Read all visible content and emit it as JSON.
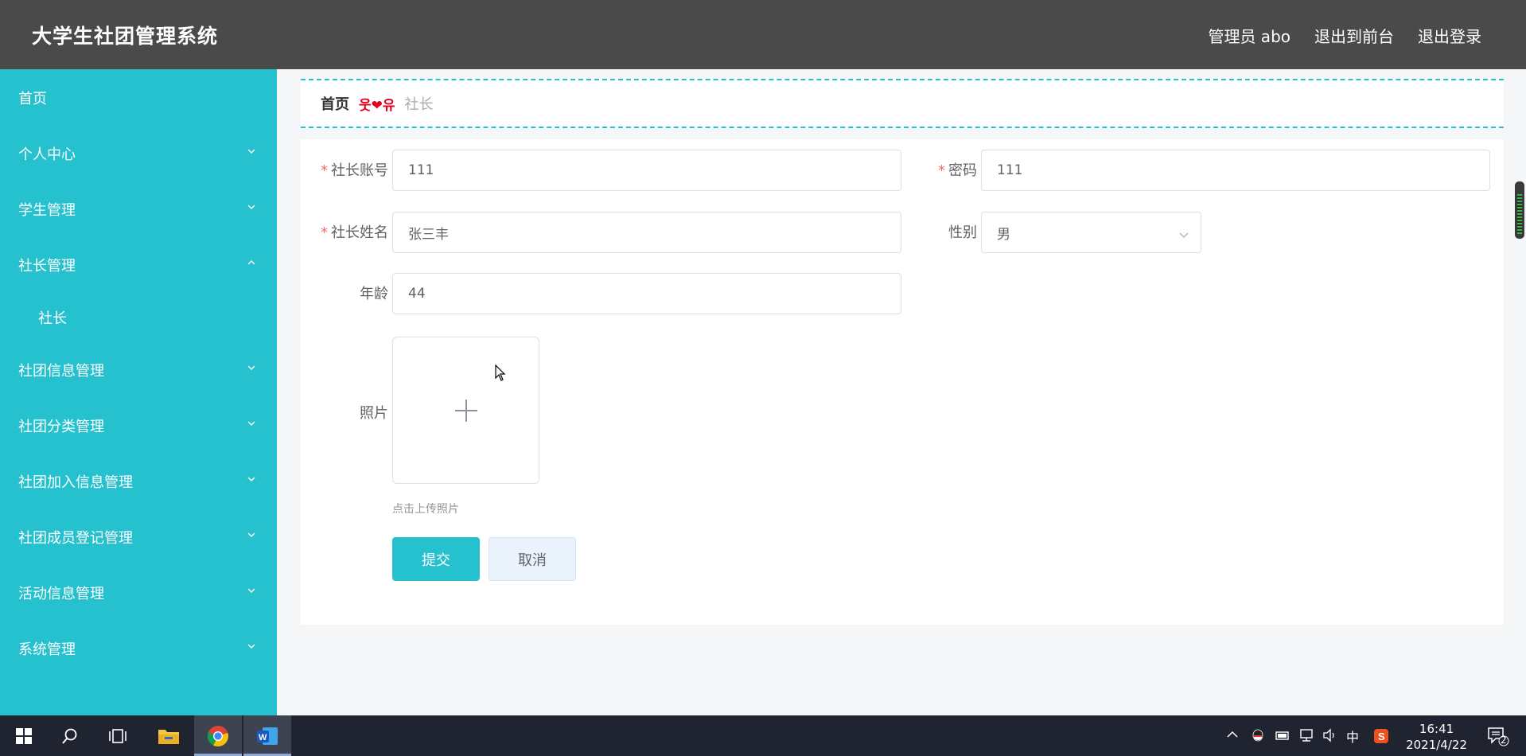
{
  "header": {
    "title": "大学生社团管理系统",
    "user": "管理员 abo",
    "to_front": "退出到前台",
    "logout": "退出登录"
  },
  "sidebar": {
    "items": [
      {
        "label": "首页"
      },
      {
        "label": "个人中心"
      },
      {
        "label": "学生管理"
      },
      {
        "label": "社长管理"
      },
      {
        "label": "社长"
      },
      {
        "label": "社团信息管理"
      },
      {
        "label": "社团分类管理"
      },
      {
        "label": "社团加入信息管理"
      },
      {
        "label": "社团成员登记管理"
      },
      {
        "label": "活动信息管理"
      },
      {
        "label": "系统管理"
      }
    ]
  },
  "breadcrumb": {
    "home": "首页",
    "separator": "웃❤유",
    "current": "社长"
  },
  "form": {
    "required_mark": "*",
    "account_label": "社长账号",
    "account_value": "111",
    "password_label": "密码",
    "password_value": "111",
    "name_label": "社长姓名",
    "name_value": "张三丰",
    "gender_label": "性别",
    "gender_value": "男",
    "age_label": "年龄",
    "age_value": "44",
    "photo_label": "照片",
    "upload_tip": "点击上传照片",
    "submit": "提交",
    "cancel": "取消"
  },
  "taskbar": {
    "time": "16:41",
    "date": "2021/4/22",
    "ime": "中",
    "notification_count": "2"
  },
  "colors": {
    "header_bg": "#4a4a4a",
    "sidebar_bg": "#26c1cf",
    "accent": "#26c1cf",
    "required": "#f56c6c"
  }
}
